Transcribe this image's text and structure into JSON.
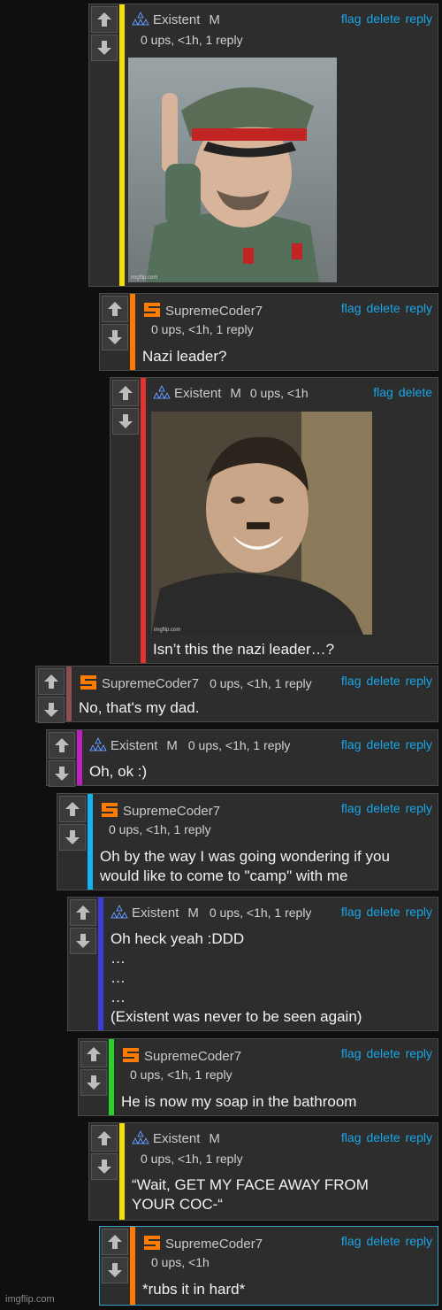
{
  "comments": [
    {
      "user": "Existent",
      "gender": "M",
      "meta": "0 ups, <1h, 1 reply",
      "actions": [
        "flag",
        "delete",
        "reply"
      ],
      "bar_color": "#f2e000"
    },
    {
      "user": "SupremeCoder7",
      "meta": "0 ups, <1h, 1 reply",
      "actions": [
        "flag",
        "delete",
        "reply"
      ],
      "text": "Nazi leader?",
      "bar_color": "#ff7b00"
    },
    {
      "user": "Existent",
      "gender": "M",
      "meta": "0 ups, <1h",
      "actions": [
        "flag",
        "delete"
      ],
      "text": "Isn’t this the nazi leader…?",
      "bar_color": "#e83232"
    },
    {
      "user": "SupremeCoder7",
      "meta": "0 ups, <1h, 1 reply",
      "actions": [
        "flag",
        "delete",
        "reply"
      ],
      "text": "No, that's my dad.",
      "bar_color": "#8a5050"
    },
    {
      "user": "Existent",
      "gender": "M",
      "meta": "0 ups, <1h, 1 reply",
      "actions": [
        "flag",
        "delete",
        "reply"
      ],
      "text": "Oh, ok :)",
      "bar_color": "#c21fc2"
    },
    {
      "user": "SupremeCoder7",
      "meta": "0 ups, <1h, 1 reply",
      "actions": [
        "flag",
        "delete",
        "reply"
      ],
      "text": "Oh by the way I was going wondering if you\nwould like to come to \"camp\" with me",
      "bar_color": "#14b4f0"
    },
    {
      "user": "Existent",
      "gender": "M",
      "meta": "0 ups, <1h, 1 reply",
      "actions": [
        "flag",
        "delete",
        "reply"
      ],
      "text": "Oh heck yeah :DDD\n…\n…\n…\n(Existent was never to be seen again)",
      "bar_color": "#3c3cdc"
    },
    {
      "user": "SupremeCoder7",
      "meta": "0 ups, <1h, 1 reply",
      "actions": [
        "flag",
        "delete",
        "reply"
      ],
      "text": "He is now my soap in the bathroom",
      "bar_color": "#28d228"
    },
    {
      "user": "Existent",
      "gender": "M",
      "meta": "0 ups, <1h, 1 reply",
      "actions": [
        "flag",
        "delete",
        "reply"
      ],
      "text": "“Wait, GET MY FACE AWAY FROM\nYOUR COC-“",
      "bar_color": "#f2e000"
    },
    {
      "user": "SupremeCoder7",
      "meta": "0 ups, <1h",
      "actions": [
        "flag",
        "delete",
        "reply"
      ],
      "text": "*rubs it in hard*",
      "bar_color": "#ff7b00"
    }
  ],
  "image_watermark": "imgflip.com",
  "footer_watermark": "imgflip.com",
  "icons": {
    "upvote": "arrow-up-icon",
    "downvote": "arrow-down-icon",
    "existent_avatar": "triangle-cluster-icon",
    "coder_avatar": "s-logo-icon"
  }
}
